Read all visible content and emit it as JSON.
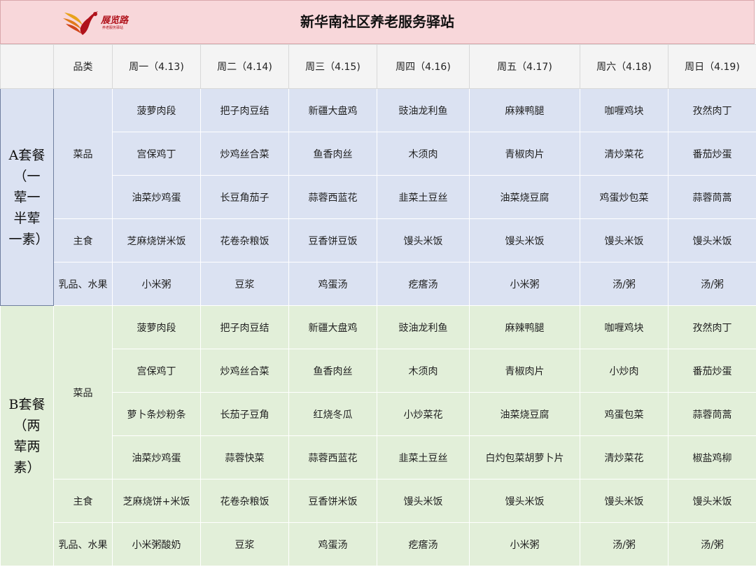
{
  "header": {
    "title": "新华南社区养老服务驿站",
    "logo_text": "展览路",
    "logo_subtext": "养老服务驿站"
  },
  "columns": [
    "品类",
    "周一（4.13)",
    "周二（4.14)",
    "周三（4.15)",
    "周四（4.16)",
    "周五（4.17)",
    "周六（4.18)",
    "周日（4.19)"
  ],
  "set_a": {
    "name": "A套餐（一荤一半荤一素）",
    "categories": {
      "dishes": "菜品",
      "staple": "主食",
      "dairy_fruit": "乳品、水果"
    },
    "dish_rows": [
      [
        "菠萝肉段",
        "把子肉豆结",
        "新疆大盘鸡",
        "豉油龙利鱼",
        "麻辣鸭腿",
        "咖喱鸡块",
        "孜然肉丁"
      ],
      [
        "宫保鸡丁",
        "炒鸡丝合菜",
        "鱼香肉丝",
        "木须肉",
        "青椒肉片",
        "清炒菜花",
        "番茄炒蛋"
      ],
      [
        "油菜炒鸡蛋",
        "长豆角茄子",
        "蒜蓉西蓝花",
        "韭菜土豆丝",
        "油菜烧豆腐",
        "鸡蛋炒包菜",
        "蒜蓉茼蒿"
      ]
    ],
    "staple_row": [
      "芝麻烧饼米饭",
      "花卷杂粮饭",
      "豆香饼豆饭",
      "馒头米饭",
      "馒头米饭",
      "馒头米饭",
      "馒头米饭"
    ],
    "dairy_row": [
      "小米粥",
      "豆浆",
      "鸡蛋汤",
      "疙瘩汤",
      "小米粥",
      "汤/粥",
      "汤/粥"
    ]
  },
  "set_b": {
    "name": "B套餐（两荤两素）",
    "categories": {
      "dishes": "菜品",
      "staple": "主食",
      "dairy_fruit": "乳品、水果"
    },
    "dish_rows": [
      [
        "菠萝肉段",
        "把子肉豆结",
        "新疆大盘鸡",
        "豉油龙利鱼",
        "麻辣鸭腿",
        "咖喱鸡块",
        "孜然肉丁"
      ],
      [
        "宫保鸡丁",
        "炒鸡丝合菜",
        "鱼香肉丝",
        "木须肉",
        "青椒肉片",
        "小炒肉",
        "番茄炒蛋"
      ],
      [
        "萝卜条炒粉条",
        "长茄子豆角",
        "红烧冬瓜",
        "小炒菜花",
        "油菜烧豆腐",
        "鸡蛋包菜",
        "蒜蓉茼蒿"
      ],
      [
        "油菜炒鸡蛋",
        "蒜蓉快菜",
        "蒜蓉西蓝花",
        "韭菜土豆丝",
        "白灼包菜胡萝卜片",
        "清炒菜花",
        "椒盐鸡柳"
      ]
    ],
    "staple_row": [
      "芝麻烧饼+米饭",
      "花卷杂粮饭",
      "豆香饼米饭",
      "馒头米饭",
      "馒头米饭",
      "馒头米饭",
      "馒头米饭"
    ],
    "dairy_row": [
      "小米粥酸奶",
      "豆浆",
      "鸡蛋汤",
      "疙瘩汤",
      "小米粥",
      "汤/粥",
      "汤/粥"
    ]
  },
  "colors": {
    "header_bg": "#f8d7da",
    "set_a_bg": "#dbe2f2",
    "set_b_bg": "#e2efd9",
    "logo": "#b0121b"
  }
}
